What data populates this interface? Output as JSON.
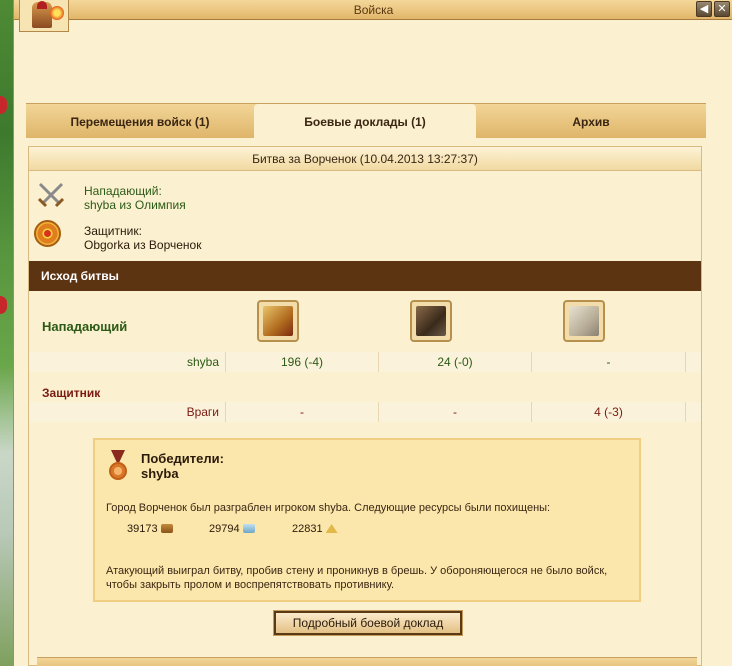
{
  "window": {
    "title": "Войска",
    "back_btn": "◀",
    "close_btn": "✕"
  },
  "tabs": [
    {
      "label": "Перемещения войск (1)",
      "active": false
    },
    {
      "label": "Боевые доклады (1)",
      "active": true
    },
    {
      "label": "Архив",
      "active": false
    }
  ],
  "report": {
    "header": "Битва за Ворченок (10.04.2013 13:27:37)",
    "attacker": {
      "label": "Нападающий:",
      "who": "shyba из Олимпия"
    },
    "defender": {
      "label": "Защитник:",
      "who": "Obgorka из Ворченок"
    },
    "outcome_title": "Исход битвы",
    "attacker_side_label": "Нападающий",
    "defender_side_label": "Защитник",
    "units": [
      "hoplite-icon",
      "catapult-icon",
      "wall-icon"
    ],
    "attacker_row": {
      "name": "shyba",
      "cells": [
        "196 (-4)",
        "24 (-0)",
        "-"
      ]
    },
    "defender_row": {
      "name": "Враги",
      "cells": [
        "-",
        "-",
        "4 (-3)"
      ]
    },
    "winner": {
      "title": "Победители:",
      "name": "shyba",
      "plunder_text": "Город Ворченок был разграблен игроком shyba. Следующие ресурсы были похищены:",
      "resources": [
        {
          "amount": "39173",
          "icon": "wood-icon"
        },
        {
          "amount": "29794",
          "icon": "stone-icon"
        },
        {
          "amount": "22831",
          "icon": "silver-icon"
        }
      ],
      "battle_text": "Атакующий выиграл битву, пробив стену и проникнув в брешь. У обороняющегося не было войск, чтобы закрыть пролом и воспрепятствовать противнику."
    },
    "detail_button": "Подробный боевой доклад"
  },
  "colors": {
    "accent_green": "#2b5a16",
    "defender_red": "#7a1a12",
    "header_brown": "#5c3412"
  }
}
